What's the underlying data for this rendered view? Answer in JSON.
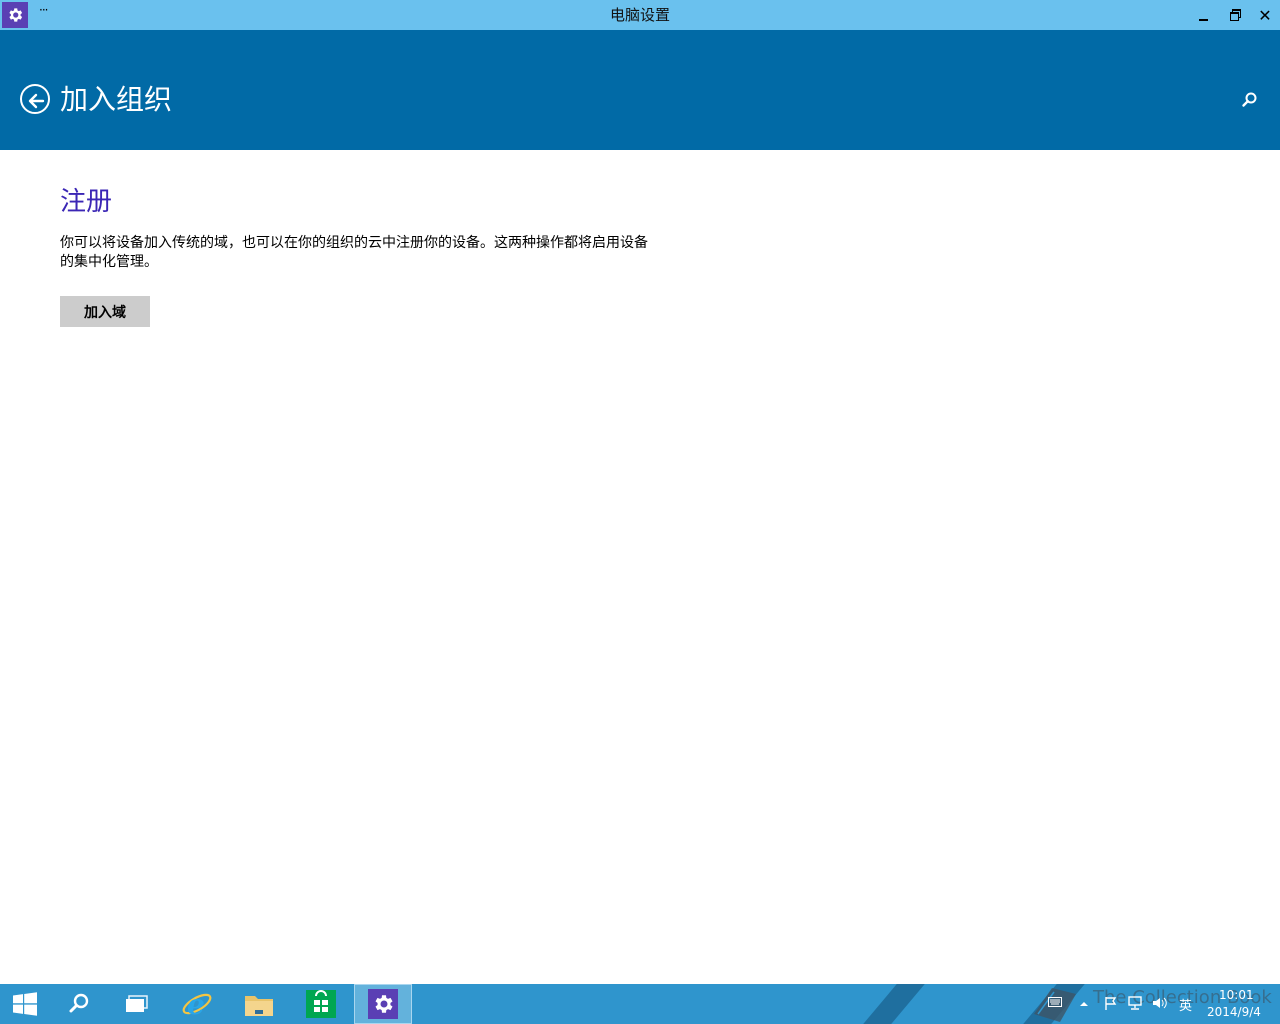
{
  "window": {
    "title": "电脑设置",
    "menu_glyph": "···",
    "minimize_icon": "minimize-icon",
    "restore_icon": "restore-icon",
    "close_glyph": "✕"
  },
  "header": {
    "title": "加入组织",
    "background": "#016aa6"
  },
  "content": {
    "section_title": "注册",
    "description": "你可以将设备加入传统的域，也可以在你的组织的云中注册你的设备。这两种操作都将启用设备的集中化管理。",
    "join_domain_button": "加入域",
    "accent_color": "#3b26b5"
  },
  "taskbar": {
    "watermark": "The Collection Book",
    "ime_indicator": "英",
    "time": "10:01",
    "date": "2014/9/4",
    "background": "#2f95cd"
  }
}
